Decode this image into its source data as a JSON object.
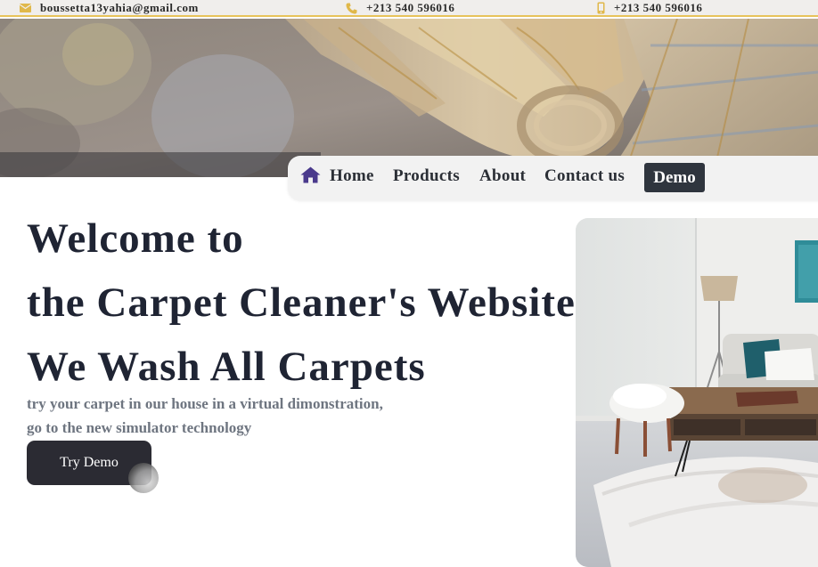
{
  "topbar": {
    "email": "boussetta13yahia@gmail.com",
    "email_icon": "envelope-icon",
    "phone": "+213 540 596016",
    "phone_icon": "phone-icon",
    "mobile": "+213 540 596016",
    "mobile_icon": "mobile-phone-icon",
    "icon_color": "#e0b84a"
  },
  "hero": {
    "image": "rolled-carpet-photo"
  },
  "nav": {
    "home_icon": "house-icon",
    "home_icon_color": "#4a3a8c",
    "items": [
      {
        "label": "Home"
      },
      {
        "label": "Products"
      },
      {
        "label": "About"
      },
      {
        "label": "Contact us"
      }
    ],
    "demo_label": "Demo"
  },
  "main": {
    "headline": [
      "Welcome to",
      "the Carpet Cleaner's Website,",
      "We Wash All Carpets"
    ],
    "subtext": [
      "try your carpet in our house in a virtual dimonstration,",
      "go to the new simulator technology"
    ],
    "cta_label": "Try Demo"
  },
  "room_image": "living-room-with-carpet-photo"
}
